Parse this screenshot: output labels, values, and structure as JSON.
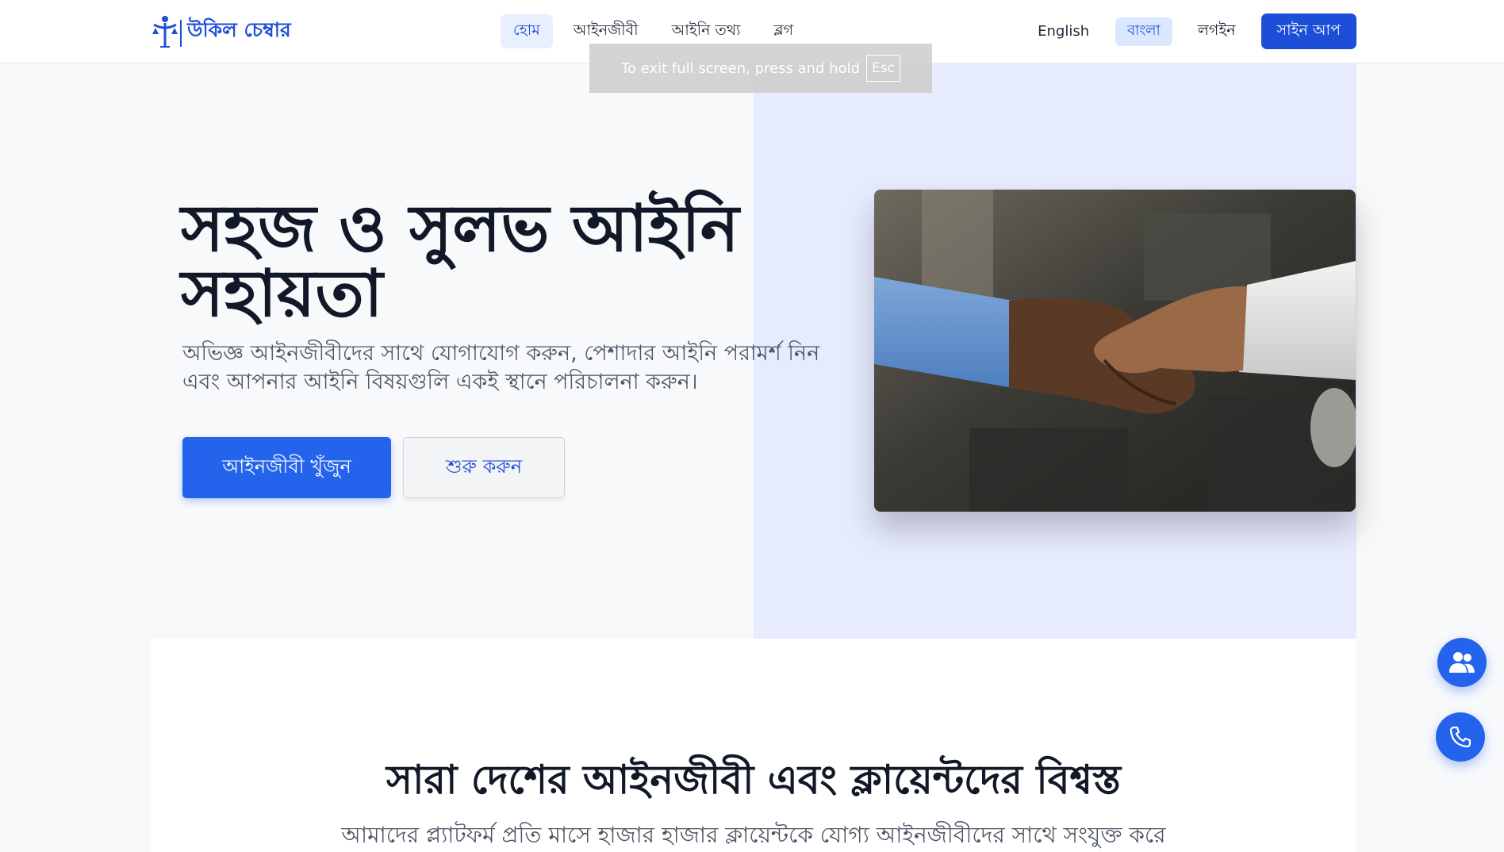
{
  "header": {
    "logo_text": "উকিল চেম্বার",
    "nav": [
      "হোম",
      "আইনজীবী",
      "আইনি তথ্য",
      "ব্লগ"
    ],
    "lang_en": "English",
    "lang_bn": "বাংলা",
    "login": "লগইন",
    "signup": "সাইন আপ"
  },
  "toast": {
    "text": "To exit full screen, press and hold",
    "key": "Esc"
  },
  "hero": {
    "title": "সহজ ও সুলভ আইনি সহায়তা",
    "subtitle": "অভিজ্ঞ আইনজীবীদের সাথে যোগাযোগ করুন, পেশাদার আইনি পরামর্শ নিন এবং আপনার আইনি বিষয়গুলি একই স্থানে পরিচালনা করুন।",
    "primary_btn": "আইনজীবী খুঁজুন",
    "secondary_btn": "শুরু করুন"
  },
  "section": {
    "title": "সারা দেশের আইনজীবী এবং ক্লায়েন্টদের বিশ্বস্ত",
    "subtitle": "আমাদের প্ল্যাটফর্ম প্রতি মাসে হাজার হাজার ক্লায়েন্টকে যোগ্য আইনজীবীদের সাথে সংযুক্ত করে"
  },
  "colors": {
    "primary": "#2463eb",
    "brand": "#1d4ed8",
    "hero_bg": "#e6ebfe"
  },
  "icons": {
    "logo": "scales-person-icon",
    "fab_top": "users-icon",
    "fab_bottom": "phone-icon",
    "hero_image": "handshake-photo"
  }
}
